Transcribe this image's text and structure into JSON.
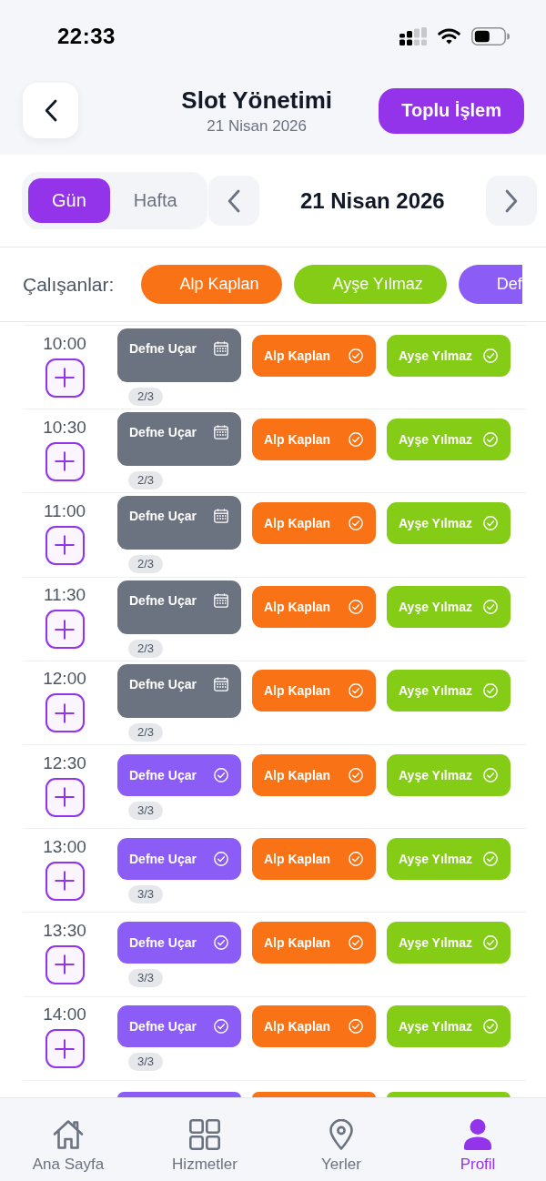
{
  "status_bar": {
    "time": "22:33"
  },
  "header": {
    "title": "Slot Yönetimi",
    "subtitle": "21 Nisan 2026",
    "action_button": "Toplu İşlem"
  },
  "view_tabs": [
    {
      "label": "Gün",
      "selected": true
    },
    {
      "label": "Hafta",
      "selected": false
    }
  ],
  "date_nav": {
    "date": "21 Nisan 2026"
  },
  "employee_filter": {
    "label": "Çalışanlar:",
    "employees": [
      {
        "name": "Alp Kaplan",
        "color": "#f97316"
      },
      {
        "name": "Ayşe Yılmaz",
        "color": "#84cc16"
      },
      {
        "name": "Def",
        "color": "#8b5cf6"
      }
    ]
  },
  "time_slots": [
    {
      "time": "10:00",
      "slots": [
        {
          "employee": "Defne Uçar",
          "kind": "booked"
        },
        {
          "employee": "Alp Kaplan",
          "kind": "available",
          "color": "#f97316"
        },
        {
          "employee": "Ayşe Yılmaz",
          "kind": "available",
          "color": "#84cc16"
        }
      ],
      "count": "2/3"
    },
    {
      "time": "10:30",
      "slots": [
        {
          "employee": "Defne Uçar",
          "kind": "booked"
        },
        {
          "employee": "Alp Kaplan",
          "kind": "available",
          "color": "#f97316"
        },
        {
          "employee": "Ayşe Yılmaz",
          "kind": "available",
          "color": "#84cc16"
        }
      ],
      "count": "2/3"
    },
    {
      "time": "11:00",
      "slots": [
        {
          "employee": "Defne Uçar",
          "kind": "booked"
        },
        {
          "employee": "Alp Kaplan",
          "kind": "available",
          "color": "#f97316"
        },
        {
          "employee": "Ayşe Yılmaz",
          "kind": "available",
          "color": "#84cc16"
        }
      ],
      "count": "2/3"
    },
    {
      "time": "11:30",
      "slots": [
        {
          "employee": "Defne Uçar",
          "kind": "booked"
        },
        {
          "employee": "Alp Kaplan",
          "kind": "available",
          "color": "#f97316"
        },
        {
          "employee": "Ayşe Yılmaz",
          "kind": "available",
          "color": "#84cc16"
        }
      ],
      "count": "2/3"
    },
    {
      "time": "12:00",
      "slots": [
        {
          "employee": "Defne Uçar",
          "kind": "booked"
        },
        {
          "employee": "Alp Kaplan",
          "kind": "available",
          "color": "#f97316"
        },
        {
          "employee": "Ayşe Yılmaz",
          "kind": "available",
          "color": "#84cc16"
        }
      ],
      "count": "2/3"
    },
    {
      "time": "12:30",
      "slots": [
        {
          "employee": "Defne Uçar",
          "kind": "available",
          "color": "#8b5cf6"
        },
        {
          "employee": "Alp Kaplan",
          "kind": "available",
          "color": "#f97316"
        },
        {
          "employee": "Ayşe Yılmaz",
          "kind": "available",
          "color": "#84cc16"
        }
      ],
      "count": "3/3"
    },
    {
      "time": "13:00",
      "slots": [
        {
          "employee": "Defne Uçar",
          "kind": "available",
          "color": "#8b5cf6"
        },
        {
          "employee": "Alp Kaplan",
          "kind": "available",
          "color": "#f97316"
        },
        {
          "employee": "Ayşe Yılmaz",
          "kind": "available",
          "color": "#84cc16"
        }
      ],
      "count": "3/3"
    },
    {
      "time": "13:30",
      "slots": [
        {
          "employee": "Defne Uçar",
          "kind": "available",
          "color": "#8b5cf6"
        },
        {
          "employee": "Alp Kaplan",
          "kind": "available",
          "color": "#f97316"
        },
        {
          "employee": "Ayşe Yılmaz",
          "kind": "available",
          "color": "#84cc16"
        }
      ],
      "count": "3/3"
    },
    {
      "time": "14:00",
      "slots": [
        {
          "employee": "Defne Uçar",
          "kind": "available",
          "color": "#8b5cf6"
        },
        {
          "employee": "Alp Kaplan",
          "kind": "available",
          "color": "#f97316"
        },
        {
          "employee": "Ayşe Yılmaz",
          "kind": "available",
          "color": "#84cc16"
        }
      ],
      "count": "3/3"
    }
  ],
  "cut_off_row": {
    "slots": [
      {
        "color": "#8b5cf6"
      },
      {
        "color": "#f97316"
      },
      {
        "color": "#84cc16"
      }
    ]
  },
  "bottom_nav": [
    {
      "label": "Ana Sayfa",
      "selected": false
    },
    {
      "label": "Hizmetler",
      "selected": false
    },
    {
      "label": "Yerler",
      "selected": false
    },
    {
      "label": "Profil",
      "selected": true
    }
  ]
}
